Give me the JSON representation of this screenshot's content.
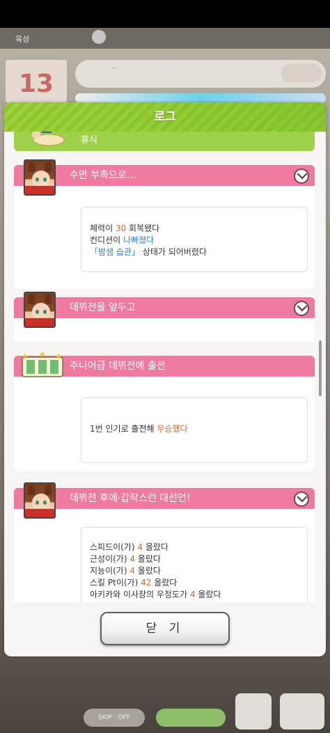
{
  "background": {
    "top_label": "육성",
    "calendar_number": "13",
    "message_text": "...",
    "skip_label": "SKIP · OFF"
  },
  "dialog": {
    "title": "로그",
    "partial_section_label": "휴식",
    "entries": [
      {
        "title": "수면 부족으로…",
        "lines": [
          [
            {
              "t": "체력이 "
            },
            {
              "t": "30",
              "c": "num"
            },
            {
              "t": " 회복됐다"
            }
          ],
          [
            {
              "t": "컨디션이 "
            },
            {
              "t": "나빠졌다",
              "c": "blue"
            }
          ],
          [
            {
              "t": "「밤샘 습관」",
              "c": "blue"
            },
            {
              "t": " 상태가 되어버렸다"
            }
          ]
        ]
      },
      {
        "title": "데뷔전을 앞두고",
        "lines": []
      },
      {
        "title": "주니어급 데뷔전에 출전",
        "lines": [
          [
            {
              "t": "1번 인기로 출전해 "
            },
            {
              "t": "우승했다",
              "c": "num"
            }
          ]
        ]
      },
      {
        "title": "데뷔전 후에·갑작스런 대선언!",
        "lines": [
          [
            {
              "t": "스피드이(가) "
            },
            {
              "t": "4",
              "c": "num"
            },
            {
              "t": " 올랐다"
            }
          ],
          [
            {
              "t": "근성이(가) "
            },
            {
              "t": "4",
              "c": "num"
            },
            {
              "t": " 올랐다"
            }
          ],
          [
            {
              "t": "지능이(가) "
            },
            {
              "t": "4",
              "c": "num"
            },
            {
              "t": " 올랐다"
            }
          ],
          [
            {
              "t": "스킬 Pt이(가) "
            },
            {
              "t": "42",
              "c": "num"
            },
            {
              "t": " 올랐다"
            }
          ],
          [
            {
              "t": "아키카와 이사장의 우정도가 "
            },
            {
              "t": "4",
              "c": "num"
            },
            {
              "t": " 올랐다"
            }
          ]
        ]
      }
    ],
    "close_label": "닫 기"
  },
  "colors": {
    "accent_green": "#9fd04a",
    "banner_pink": "#ef7aa0",
    "highlight_orange": "#e0662a",
    "highlight_blue": "#2f82d6"
  },
  "icons": [
    "chevron-down-icon",
    "character-portrait",
    "ticket-icon",
    "scrollbar"
  ]
}
